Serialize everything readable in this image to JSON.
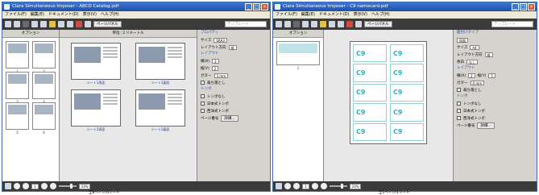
{
  "window1": {
    "title": "Clara Simultaneous Imposer - ABCD Catalog.pdf",
    "menu": [
      "ファイル(F)",
      "編集(E)",
      "ドキュメント(D)",
      "表示(V)",
      "ヘルプ(H)"
    ],
    "search_placeholder": "テンプレート",
    "pin_button": "ページパネル",
    "thumbs_header": "オプション",
    "thumb_labels": [
      "1",
      "2",
      "3",
      "4",
      "5",
      "6"
    ],
    "preview_header": "単位: ミリメートル",
    "page_captions": [
      "シート1表面",
      "シート1裏面",
      "シート2表面",
      "シート2裏面"
    ],
    "props": {
      "section_title": "プロパティ",
      "size_label": "サイズ",
      "size_value": "SRA3",
      "paper_label": "レイアウト方向",
      "paper_value": "縦",
      "layout_title": "レイアウト",
      "cols_label": "横(X)",
      "cols_value": "2",
      "rows_label": "縦(Y)",
      "rows_value": "2",
      "gutter_label": "ガター",
      "gutter_value": "3 mm",
      "bleed_label": "裁ち落とし",
      "marks_title": "トンボ",
      "marks_options": [
        "トンボなし",
        "日本式トンボ",
        "西洋式トンボ"
      ],
      "pagenum_label": "ページ番号",
      "detail_button": "詳細..."
    },
    "status": {
      "zoom": "33%",
      "page": "1",
      "page_count": "全8ページ/4シート"
    }
  },
  "window2": {
    "title": "Clara Simultaneous Imposer - C9 namecard.pdf",
    "menu": [
      "ファイル(F)",
      "編集(E)",
      "ドキュメント(D)",
      "表示(V)",
      "ヘルプ(H)"
    ],
    "search_placeholder": "テンプレート",
    "pin_button": "ページパネル",
    "thumbs_header": "オプション",
    "thumb_labels": [
      "1"
    ],
    "preview_header": "",
    "card_text": "C9",
    "props": {
      "section_title": "面付けタイプ",
      "type_value": "同面",
      "size_label": "サイズ",
      "size_value": "A4",
      "paper_label": "レイアウト方向",
      "paper_value": "縦",
      "margin_label": "余白",
      "margin_value": "なし",
      "layout_title": "レイアウト",
      "cols_label": "横(X)",
      "cols_value": "2",
      "rows_label": "縦(Y)",
      "rows_value": "5",
      "gutter_label": "ガター",
      "gutter_value": "0 mm",
      "bleed_label": "裁ち落とし",
      "marks_title": "トンボ",
      "marks_options": [
        "トンボなし",
        "日本式トンボ",
        "西洋式トンボ"
      ],
      "pagenum_label": "ページ番号",
      "detail_button": "詳細..."
    },
    "status": {
      "zoom": "33%",
      "page": "1",
      "page_count": "全1ページ/1シート"
    }
  }
}
